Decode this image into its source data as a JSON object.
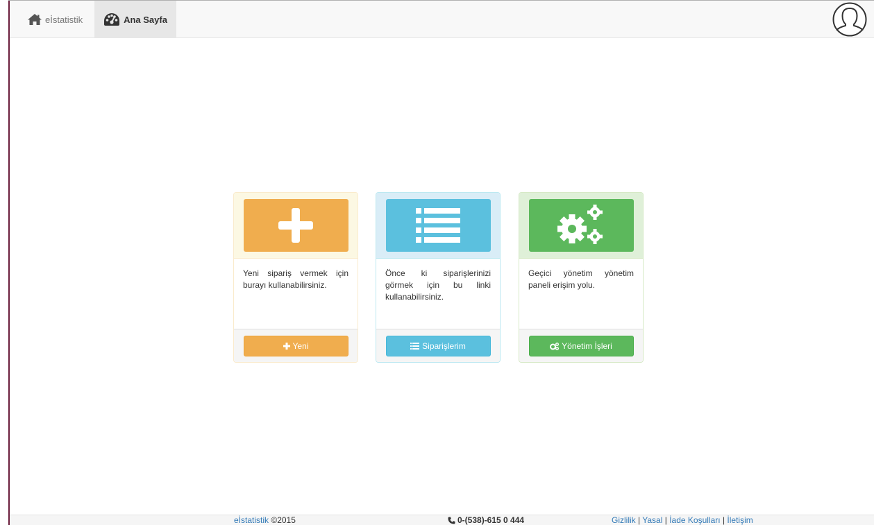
{
  "navbar": {
    "brand_label": "eİstatistik",
    "home_label": "Ana Sayfa"
  },
  "cards": [
    {
      "description": "Yeni sipariş vermek için burayı kullanabilirsiniz.",
      "button_label": "Yeni",
      "icon": "plus-icon",
      "color": "#f0ad4e"
    },
    {
      "description": "Önce ki siparişlerinizi görmek için bu linki kullanabilirsiniz.",
      "button_label": "Siparişlerim",
      "icon": "list-icon",
      "color": "#5bc0de"
    },
    {
      "description": "Geçici yönetim yönetim paneli erişim yolu.",
      "button_label": "Yönetim İşleri",
      "icon": "gears-icon",
      "color": "#5cb85c"
    }
  ],
  "footer": {
    "brand_link": "eİstatistik",
    "copyright": "©2015",
    "phone": "0-(538)-615 0 444",
    "links": [
      "Gizlilik",
      "Yasal",
      "İade Koşulları",
      "İletişim"
    ],
    "separator": "|"
  }
}
